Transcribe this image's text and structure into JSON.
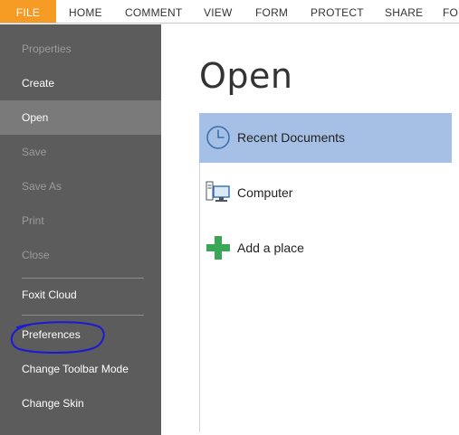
{
  "ribbon": {
    "tabs": [
      {
        "label": "FILE",
        "active": true
      },
      {
        "label": "HOME"
      },
      {
        "label": "COMMENT"
      },
      {
        "label": "VIEW"
      },
      {
        "label": "FORM"
      },
      {
        "label": "PROTECT"
      },
      {
        "label": "SHARE"
      },
      {
        "label": "FO"
      }
    ]
  },
  "sidebar": {
    "items": [
      {
        "label": "Properties",
        "state": "disabled"
      },
      {
        "label": "Create",
        "state": "enabled"
      },
      {
        "label": "Open",
        "state": "selected"
      },
      {
        "label": "Save",
        "state": "disabled"
      },
      {
        "label": "Save As",
        "state": "disabled"
      },
      {
        "label": "Print",
        "state": "disabled"
      },
      {
        "label": "Close",
        "state": "disabled"
      },
      {
        "label": "Foxit Cloud",
        "state": "enabled"
      },
      {
        "label": "Preferences",
        "state": "enabled",
        "annotated": true
      },
      {
        "label": "Change Toolbar Mode",
        "state": "enabled"
      },
      {
        "label": "Change Skin",
        "state": "enabled"
      }
    ]
  },
  "main": {
    "title": "Open",
    "places": [
      {
        "label": "Recent Documents",
        "icon": "clock-icon",
        "selected": true
      },
      {
        "label": "Computer",
        "icon": "computer-icon"
      },
      {
        "label": "Add a place",
        "icon": "plus-icon"
      }
    ]
  },
  "colors": {
    "file_tab": "#f59a23",
    "sidebar_bg": "#5c5c5c",
    "selected_item_bg": "#7a7a7a",
    "selected_place_bg": "#a6c0e5",
    "annotation_stroke": "#1a1ad6",
    "plus_icon": "#3aa757"
  }
}
